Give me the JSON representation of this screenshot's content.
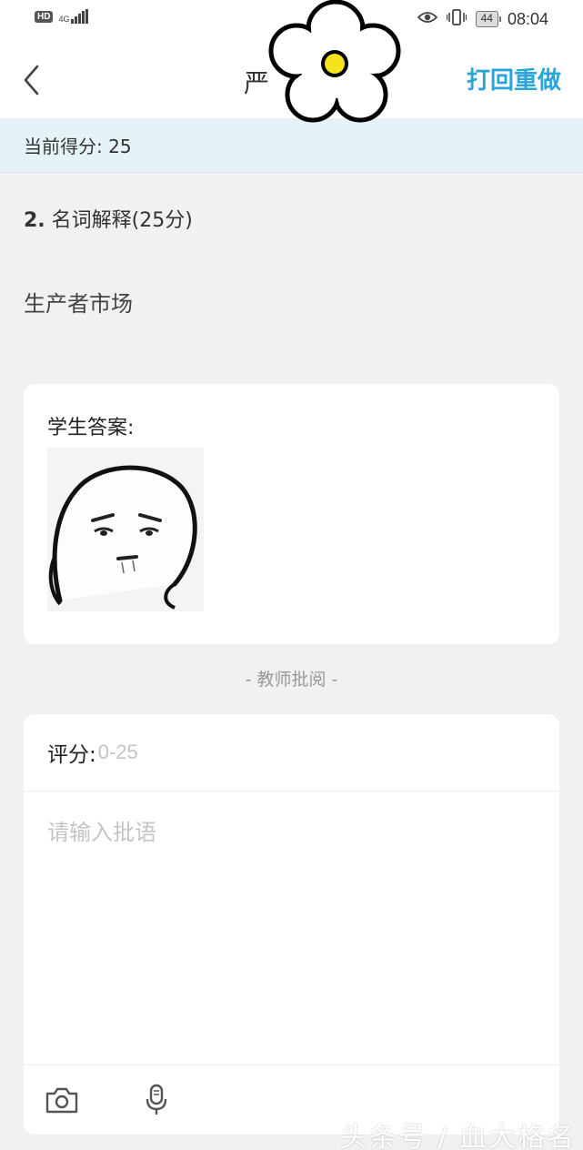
{
  "status_bar": {
    "hd": "HD",
    "network": "4G",
    "battery": "44",
    "time": "08:04"
  },
  "nav": {
    "title": "严",
    "action_label": "打回重做"
  },
  "score_strip": {
    "text": "当前得分: 25"
  },
  "question": {
    "number": "2.",
    "title": "名词解释(25分)",
    "term": "生产者市场"
  },
  "answer": {
    "label": "学生答案:"
  },
  "review": {
    "divider": "- 教师批阅 -",
    "score_label": "评分:",
    "score_placeholder": "0-25",
    "comment_placeholder": "请输入批语"
  },
  "watermark": "头条号 / 血大格名",
  "colors": {
    "accent": "#2ba4d8",
    "score_strip_bg": "#e5f3f9",
    "page_bg": "#f1f1f3",
    "flower_center": "#f6e21a"
  },
  "icons": [
    "back-chevron-icon",
    "eye-icon",
    "vibrate-icon",
    "camera-icon",
    "microphone-icon",
    "flower-sticker"
  ]
}
